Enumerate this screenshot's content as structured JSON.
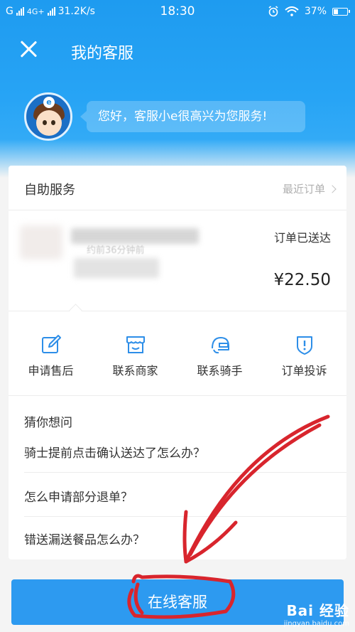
{
  "status_bar": {
    "carrier1": "G",
    "carrier2": "4G+",
    "speed": "31.2K/s",
    "time": "18:30",
    "battery": "37%",
    "battery_level": 0.37
  },
  "nav": {
    "title": "我的客服",
    "close_icon": "close-icon"
  },
  "greeting": "您好，客服小e很高兴为您服务!",
  "self_service": {
    "title": "自助服务",
    "recent_orders": "最近订单"
  },
  "order": {
    "time": "约前36分钟前",
    "status": "订单已送达",
    "price": "¥22.50"
  },
  "actions": [
    {
      "label": "申请售后",
      "icon": "edit-icon"
    },
    {
      "label": "联系商家",
      "icon": "shop-icon"
    },
    {
      "label": "联系骑手",
      "icon": "rider-helmet-icon"
    },
    {
      "label": "订单投诉",
      "icon": "shield-alert-icon"
    }
  ],
  "faq": {
    "title": "猜你想问",
    "questions": [
      "骑士提前点击确认送达了怎么办？",
      "怎么申请部分退单？",
      "错送漏送餐品怎么办？"
    ]
  },
  "bottom_button": "在线客服",
  "watermark": {
    "logo": "Bai 经验",
    "site": "jingyan.baidu.com"
  },
  "colors": {
    "brand_blue": "#1e9bf0",
    "button_blue": "#2d9af0",
    "annotation_red": "#d8252d"
  }
}
